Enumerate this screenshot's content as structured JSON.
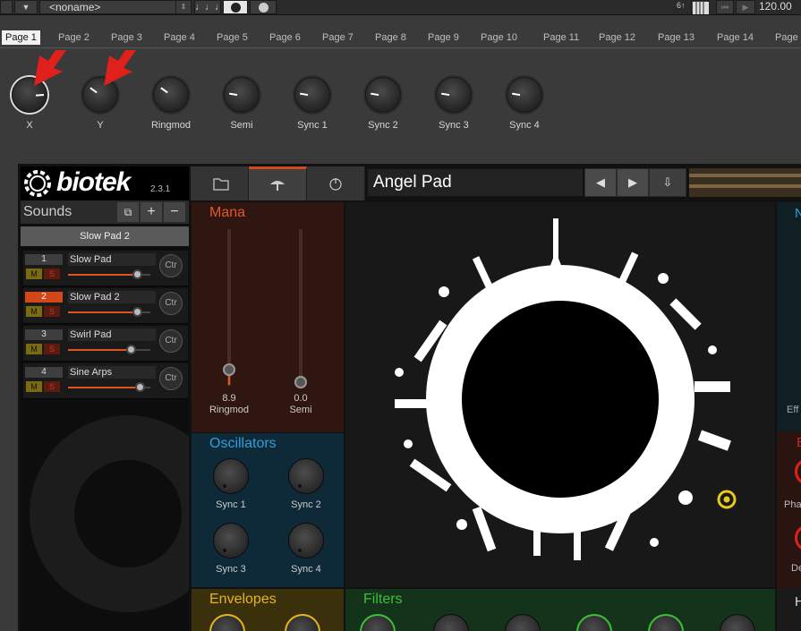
{
  "topbar": {
    "preset_name": "<noname>",
    "tempo": "120.00",
    "beat_count": "6↑"
  },
  "pages": {
    "tabs": [
      "Page 1",
      "Page 2",
      "Page 3",
      "Page 4",
      "Page 5",
      "Page 6",
      "Page 7",
      "Page 8",
      "Page 9",
      "Page 10",
      "Page 11",
      "Page 12",
      "Page 13",
      "Page 14",
      "Page"
    ],
    "active_index": 0
  },
  "knobs": [
    {
      "label": "X",
      "value": 0.82
    },
    {
      "label": "Y",
      "value": 0.3
    },
    {
      "label": "Ringmod",
      "value": 0.3
    },
    {
      "label": "Semi",
      "value": 0.2
    },
    {
      "label": "Sync 1",
      "value": 0.2
    },
    {
      "label": "Sync 2",
      "value": 0.2
    },
    {
      "label": "Sync 3",
      "value": 0.2
    },
    {
      "label": "Sync 4",
      "value": 0.2
    }
  ],
  "plugin": {
    "brand": "biotek",
    "version": "2.3.1",
    "sounds_title": "Sounds",
    "sound_selected": "Slow Pad 2",
    "preset": "Angel Pad",
    "slots": [
      {
        "num": "1",
        "name": "Slow Pad",
        "m": "M",
        "s": "S",
        "level": 0.84,
        "ctr": "Ctr",
        "active": false
      },
      {
        "num": "2",
        "name": "Slow Pad 2",
        "m": "M",
        "s": "S",
        "level": 0.84,
        "ctr": "Ctr",
        "active": true
      },
      {
        "num": "3",
        "name": "Swirl Pad",
        "m": "M",
        "s": "S",
        "level": 0.76,
        "ctr": "Ctr",
        "active": false
      },
      {
        "num": "4",
        "name": "Sine Arps",
        "m": "M",
        "s": "S",
        "level": 0.87,
        "ctr": "Ctr",
        "active": false
      }
    ],
    "mana": {
      "title": "Mana",
      "sliders": [
        {
          "label": "Ringmod",
          "value": "8.9",
          "level": 0.09
        },
        {
          "label": "Semi",
          "value": "0.0",
          "level": 0.0
        }
      ]
    },
    "oscillators": {
      "title": "Oscillators",
      "knobs": [
        "Sync 1",
        "Sync 2",
        "Sync 3",
        "Sync 4"
      ]
    },
    "envelopes_title": "Envelopes",
    "filters_title": "Filters",
    "right_labels": {
      "top": "N",
      "effects": "Eff",
      "b": "B",
      "phase": "Pha",
      "de": "De",
      "h": "H"
    }
  },
  "colors": {
    "accent_orange": "#d2481a",
    "mana_title": "#e0582a",
    "osc_title": "#2f9fdc",
    "env_title": "#e6b520",
    "filt_title": "#3fbf3a",
    "red_arrow": "#e0201a"
  }
}
